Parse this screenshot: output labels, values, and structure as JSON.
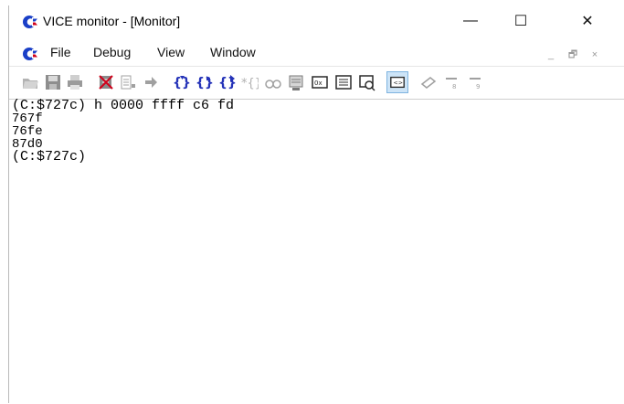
{
  "window": {
    "title": "VICE monitor - [Monitor]",
    "minimize_label": "—",
    "maximize_label": "☐",
    "close_label": "✕"
  },
  "menu": {
    "items": [
      "File",
      "Debug",
      "View",
      "Window"
    ],
    "mdi_min": "_",
    "mdi_restore": "🗗",
    "mdi_close": "×"
  },
  "toolbar": {
    "icons": [
      "open-icon",
      "save-icon",
      "print-icon",
      "disable-icon",
      "step-over-icon",
      "step-icon",
      "step-into-icon",
      "step-out-icon",
      "return-icon",
      "brace-icon",
      "watch-icon",
      "memory-icon",
      "disassembly-icon",
      "registers-icon",
      "breakpoint-icon",
      "console-icon",
      "eraser-icon",
      "pin-icon"
    ]
  },
  "console": {
    "prompt1": "(C:$727c) h 0000 ffff c6 fd",
    "out1": "767f",
    "out2": "76fe",
    "out3": "87d0",
    "prompt2": "(C:$727c)"
  },
  "colors": {
    "brand_blue": "#1a3fc7",
    "toolbar_gray": "#9a9a9a",
    "toolbar_blue": "#2432b8"
  }
}
